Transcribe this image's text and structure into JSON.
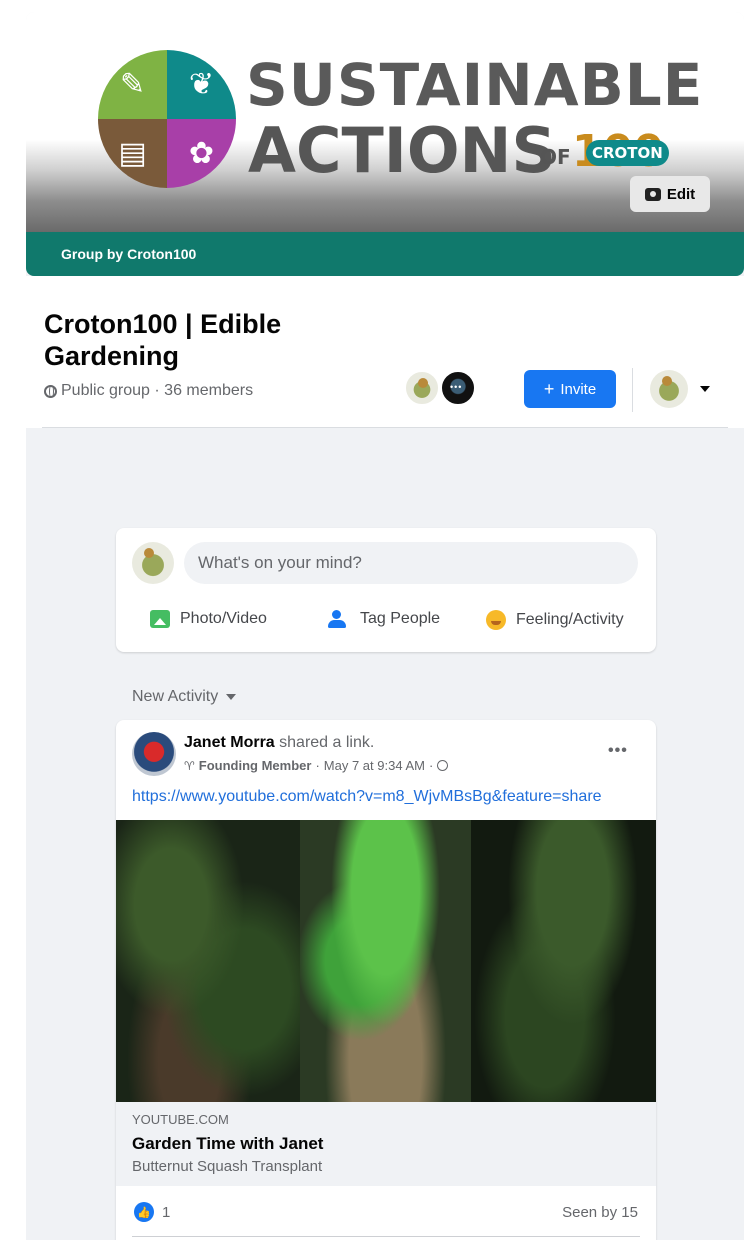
{
  "cover": {
    "logo_line1": "SUSTAINABLE",
    "logo_line2": "ACTIONS",
    "logo_of": "OF",
    "logo_100": "100",
    "logo_croton": "CROTON",
    "edit_label": "Edit"
  },
  "group_bar": {
    "label": "Group by Croton100"
  },
  "header": {
    "title": "Croton100 | Edible Gardening",
    "meta": "Public group · 36 members",
    "invite_label": "Invite"
  },
  "composer": {
    "placeholder": "What's on your mind?",
    "actions": [
      {
        "label": "Photo/Video"
      },
      {
        "label": "Tag People"
      },
      {
        "label": "Feeling/Activity"
      }
    ]
  },
  "feed": {
    "sort_label": "New Activity"
  },
  "post": {
    "author": "Janet Morra",
    "action": "shared a link.",
    "badge": "Founding Member",
    "time": "May 7 at 9:34 AM",
    "link": "https://www.youtube.com/watch?v=m8_WjvMBsBg&feature=share",
    "card": {
      "domain": "YOUTUBE.COM",
      "title": "Garden Time with Janet",
      "description": "Butternut Squash Transplant"
    },
    "likes": "1",
    "seen_by": "Seen by 15"
  },
  "colors": {
    "accent": "#1877f2",
    "group_bar": "#10796c",
    "page_bg": "#f0f2f5"
  }
}
